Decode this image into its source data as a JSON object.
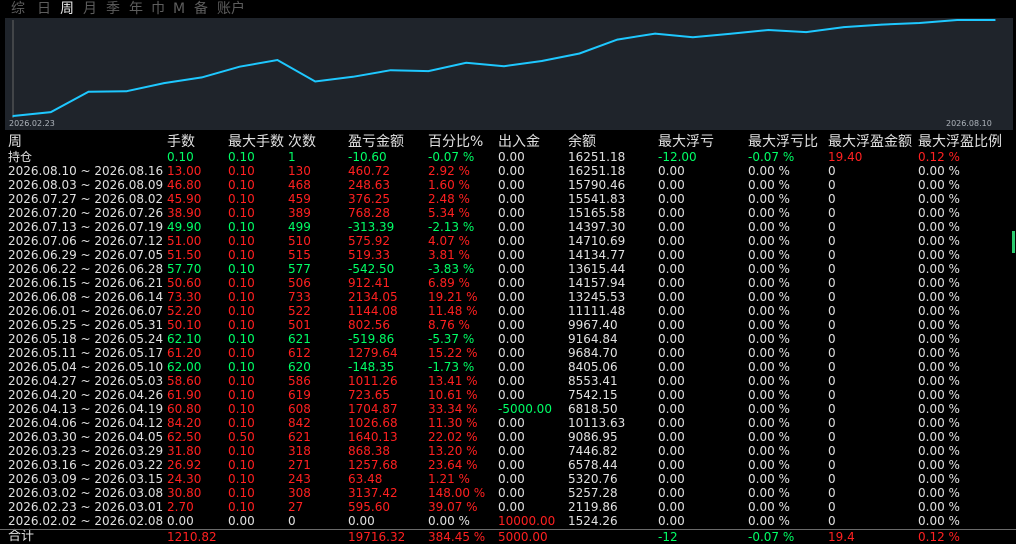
{
  "tabs": [
    "综",
    "日",
    "周",
    "月",
    "季",
    "年",
    "巾",
    "M",
    "备",
    "账户"
  ],
  "active_tab": "周",
  "chart_data": {
    "type": "line",
    "series_color": "#1ec8ff",
    "x_start_label": "2026.02.23",
    "x_end_label": "2026.08.10",
    "x": [
      "2026.02.02",
      "2026.02.23",
      "2026.03.02",
      "2026.03.09",
      "2026.03.16",
      "2026.03.23",
      "2026.03.30",
      "2026.04.06",
      "2026.04.13",
      "2026.04.20",
      "2026.04.27",
      "2026.05.04",
      "2026.05.11",
      "2026.05.18",
      "2026.05.25",
      "2026.06.01",
      "2026.06.08",
      "2026.06.15",
      "2026.06.22",
      "2026.06.29",
      "2026.07.06",
      "2026.07.13",
      "2026.07.20",
      "2026.07.27",
      "2026.08.03",
      "2026.08.10",
      "持仓"
    ],
    "values": [
      1524.26,
      2119.86,
      5257.28,
      5320.76,
      6578.44,
      7446.82,
      9086.95,
      10113.63,
      6818.5,
      7542.15,
      8553.41,
      8405.06,
      9684.7,
      9164.84,
      9967.4,
      11111.48,
      13245.53,
      14157.94,
      13615.44,
      14134.77,
      14710.69,
      14397.3,
      15165.58,
      15541.83,
      15790.46,
      16251.18,
      16251.18
    ]
  },
  "headers": [
    "周",
    "手数",
    "最大手数",
    "次数",
    "盈亏金额",
    "百分比%",
    "出入金",
    "余额",
    "最大浮亏",
    "最大浮亏比",
    "最大浮盈金额",
    "最大浮盈比例"
  ],
  "rows": [
    {
      "c": [
        "持仓",
        "0.10",
        "0.10",
        "1",
        "-10.60",
        "-0.07 %",
        "0.00",
        "16251.18",
        "-12.00",
        "-0.07 %",
        "19.40",
        "0.12 %"
      ],
      "col": [
        "w",
        "g",
        "g",
        "g",
        "g",
        "g",
        "w",
        "w",
        "g",
        "g",
        "r",
        "r"
      ]
    },
    {
      "c": [
        "2026.08.10 ~ 2026.08.16",
        "13.00",
        "0.10",
        "130",
        "460.72",
        "2.92 %",
        "0.00",
        "16251.18",
        "0.00",
        "0.00 %",
        "0",
        "0.00 %"
      ],
      "col": [
        "w",
        "r",
        "r",
        "r",
        "r",
        "r",
        "w",
        "w",
        "w",
        "w",
        "w",
        "w"
      ]
    },
    {
      "c": [
        "2026.08.03 ~ 2026.08.09",
        "46.80",
        "0.10",
        "468",
        "248.63",
        "1.60 %",
        "0.00",
        "15790.46",
        "0.00",
        "0.00 %",
        "0",
        "0.00 %"
      ],
      "col": [
        "w",
        "r",
        "r",
        "r",
        "r",
        "r",
        "w",
        "w",
        "w",
        "w",
        "w",
        "w"
      ]
    },
    {
      "c": [
        "2026.07.27 ~ 2026.08.02",
        "45.90",
        "0.10",
        "459",
        "376.25",
        "2.48 %",
        "0.00",
        "15541.83",
        "0.00",
        "0.00 %",
        "0",
        "0.00 %"
      ],
      "col": [
        "w",
        "r",
        "r",
        "r",
        "r",
        "r",
        "w",
        "w",
        "w",
        "w",
        "w",
        "w"
      ]
    },
    {
      "c": [
        "2026.07.20 ~ 2026.07.26",
        "38.90",
        "0.10",
        "389",
        "768.28",
        "5.34 %",
        "0.00",
        "15165.58",
        "0.00",
        "0.00 %",
        "0",
        "0.00 %"
      ],
      "col": [
        "w",
        "r",
        "r",
        "r",
        "r",
        "r",
        "w",
        "w",
        "w",
        "w",
        "w",
        "w"
      ]
    },
    {
      "c": [
        "2026.07.13 ~ 2026.07.19",
        "49.90",
        "0.10",
        "499",
        "-313.39",
        "-2.13 %",
        "0.00",
        "14397.30",
        "0.00",
        "0.00 %",
        "0",
        "0.00 %"
      ],
      "col": [
        "w",
        "g",
        "g",
        "g",
        "g",
        "g",
        "w",
        "w",
        "w",
        "w",
        "w",
        "w"
      ]
    },
    {
      "c": [
        "2026.07.06 ~ 2026.07.12",
        "51.00",
        "0.10",
        "510",
        "575.92",
        "4.07 %",
        "0.00",
        "14710.69",
        "0.00",
        "0.00 %",
        "0",
        "0.00 %"
      ],
      "col": [
        "w",
        "r",
        "r",
        "r",
        "r",
        "r",
        "w",
        "w",
        "w",
        "w",
        "w",
        "w"
      ]
    },
    {
      "c": [
        "2026.06.29 ~ 2026.07.05",
        "51.50",
        "0.10",
        "515",
        "519.33",
        "3.81 %",
        "0.00",
        "14134.77",
        "0.00",
        "0.00 %",
        "0",
        "0.00 %"
      ],
      "col": [
        "w",
        "r",
        "r",
        "r",
        "r",
        "r",
        "w",
        "w",
        "w",
        "w",
        "w",
        "w"
      ]
    },
    {
      "c": [
        "2026.06.22 ~ 2026.06.28",
        "57.70",
        "0.10",
        "577",
        "-542.50",
        "-3.83 %",
        "0.00",
        "13615.44",
        "0.00",
        "0.00 %",
        "0",
        "0.00 %"
      ],
      "col": [
        "w",
        "g",
        "g",
        "g",
        "g",
        "g",
        "w",
        "w",
        "w",
        "w",
        "w",
        "w"
      ]
    },
    {
      "c": [
        "2026.06.15 ~ 2026.06.21",
        "50.60",
        "0.10",
        "506",
        "912.41",
        "6.89 %",
        "0.00",
        "14157.94",
        "0.00",
        "0.00 %",
        "0",
        "0.00 %"
      ],
      "col": [
        "w",
        "r",
        "r",
        "r",
        "r",
        "r",
        "w",
        "w",
        "w",
        "w",
        "w",
        "w"
      ]
    },
    {
      "c": [
        "2026.06.08 ~ 2026.06.14",
        "73.30",
        "0.10",
        "733",
        "2134.05",
        "19.21 %",
        "0.00",
        "13245.53",
        "0.00",
        "0.00 %",
        "0",
        "0.00 %"
      ],
      "col": [
        "w",
        "r",
        "r",
        "r",
        "r",
        "r",
        "w",
        "w",
        "w",
        "w",
        "w",
        "w"
      ]
    },
    {
      "c": [
        "2026.06.01 ~ 2026.06.07",
        "52.20",
        "0.10",
        "522",
        "1144.08",
        "11.48 %",
        "0.00",
        "11111.48",
        "0.00",
        "0.00 %",
        "0",
        "0.00 %"
      ],
      "col": [
        "w",
        "r",
        "r",
        "r",
        "r",
        "r",
        "w",
        "w",
        "w",
        "w",
        "w",
        "w"
      ]
    },
    {
      "c": [
        "2026.05.25 ~ 2026.05.31",
        "50.10",
        "0.10",
        "501",
        "802.56",
        "8.76 %",
        "0.00",
        "9967.40",
        "0.00",
        "0.00 %",
        "0",
        "0.00 %"
      ],
      "col": [
        "w",
        "r",
        "r",
        "r",
        "r",
        "r",
        "w",
        "w",
        "w",
        "w",
        "w",
        "w"
      ]
    },
    {
      "c": [
        "2026.05.18 ~ 2026.05.24",
        "62.10",
        "0.10",
        "621",
        "-519.86",
        "-5.37 %",
        "0.00",
        "9164.84",
        "0.00",
        "0.00 %",
        "0",
        "0.00 %"
      ],
      "col": [
        "w",
        "g",
        "g",
        "g",
        "g",
        "g",
        "w",
        "w",
        "w",
        "w",
        "w",
        "w"
      ]
    },
    {
      "c": [
        "2026.05.11 ~ 2026.05.17",
        "61.20",
        "0.10",
        "612",
        "1279.64",
        "15.22 %",
        "0.00",
        "9684.70",
        "0.00",
        "0.00 %",
        "0",
        "0.00 %"
      ],
      "col": [
        "w",
        "r",
        "r",
        "r",
        "r",
        "r",
        "w",
        "w",
        "w",
        "w",
        "w",
        "w"
      ]
    },
    {
      "c": [
        "2026.05.04 ~ 2026.05.10",
        "62.00",
        "0.10",
        "620",
        "-148.35",
        "-1.73 %",
        "0.00",
        "8405.06",
        "0.00",
        "0.00 %",
        "0",
        "0.00 %"
      ],
      "col": [
        "w",
        "g",
        "g",
        "g",
        "g",
        "g",
        "w",
        "w",
        "w",
        "w",
        "w",
        "w"
      ]
    },
    {
      "c": [
        "2026.04.27 ~ 2026.05.03",
        "58.60",
        "0.10",
        "586",
        "1011.26",
        "13.41 %",
        "0.00",
        "8553.41",
        "0.00",
        "0.00 %",
        "0",
        "0.00 %"
      ],
      "col": [
        "w",
        "r",
        "r",
        "r",
        "r",
        "r",
        "w",
        "w",
        "w",
        "w",
        "w",
        "w"
      ]
    },
    {
      "c": [
        "2026.04.20 ~ 2026.04.26",
        "61.90",
        "0.10",
        "619",
        "723.65",
        "10.61 %",
        "0.00",
        "7542.15",
        "0.00",
        "0.00 %",
        "0",
        "0.00 %"
      ],
      "col": [
        "w",
        "r",
        "r",
        "r",
        "r",
        "r",
        "w",
        "w",
        "w",
        "w",
        "w",
        "w"
      ]
    },
    {
      "c": [
        "2026.04.13 ~ 2026.04.19",
        "60.80",
        "0.10",
        "608",
        "1704.87",
        "33.34 %",
        "-5000.00",
        "6818.50",
        "0.00",
        "0.00 %",
        "0",
        "0.00 %"
      ],
      "col": [
        "w",
        "r",
        "r",
        "r",
        "r",
        "r",
        "g",
        "w",
        "w",
        "w",
        "w",
        "w"
      ]
    },
    {
      "c": [
        "2026.04.06 ~ 2026.04.12",
        "84.20",
        "0.10",
        "842",
        "1026.68",
        "11.30 %",
        "0.00",
        "10113.63",
        "0.00",
        "0.00 %",
        "0",
        "0.00 %"
      ],
      "col": [
        "w",
        "r",
        "r",
        "r",
        "r",
        "r",
        "w",
        "w",
        "w",
        "w",
        "w",
        "w"
      ]
    },
    {
      "c": [
        "2026.03.30 ~ 2026.04.05",
        "62.50",
        "0.50",
        "621",
        "1640.13",
        "22.02 %",
        "0.00",
        "9086.95",
        "0.00",
        "0.00 %",
        "0",
        "0.00 %"
      ],
      "col": [
        "w",
        "r",
        "r",
        "r",
        "r",
        "r",
        "w",
        "w",
        "w",
        "w",
        "w",
        "w"
      ]
    },
    {
      "c": [
        "2026.03.23 ~ 2026.03.29",
        "31.80",
        "0.10",
        "318",
        "868.38",
        "13.20 %",
        "0.00",
        "7446.82",
        "0.00",
        "0.00 %",
        "0",
        "0.00 %"
      ],
      "col": [
        "w",
        "r",
        "r",
        "r",
        "r",
        "r",
        "w",
        "w",
        "w",
        "w",
        "w",
        "w"
      ]
    },
    {
      "c": [
        "2026.03.16 ~ 2026.03.22",
        "26.92",
        "0.10",
        "271",
        "1257.68",
        "23.64 %",
        "0.00",
        "6578.44",
        "0.00",
        "0.00 %",
        "0",
        "0.00 %"
      ],
      "col": [
        "w",
        "r",
        "r",
        "r",
        "r",
        "r",
        "w",
        "w",
        "w",
        "w",
        "w",
        "w"
      ]
    },
    {
      "c": [
        "2026.03.09 ~ 2026.03.15",
        "24.30",
        "0.10",
        "243",
        "63.48",
        "1.21 %",
        "0.00",
        "5320.76",
        "0.00",
        "0.00 %",
        "0",
        "0.00 %"
      ],
      "col": [
        "w",
        "r",
        "r",
        "r",
        "r",
        "r",
        "w",
        "w",
        "w",
        "w",
        "w",
        "w"
      ]
    },
    {
      "c": [
        "2026.03.02 ~ 2026.03.08",
        "30.80",
        "0.10",
        "308",
        "3137.42",
        "148.00 %",
        "0.00",
        "5257.28",
        "0.00",
        "0.00 %",
        "0",
        "0.00 %"
      ],
      "col": [
        "w",
        "r",
        "r",
        "r",
        "r",
        "r",
        "w",
        "w",
        "w",
        "w",
        "w",
        "w"
      ]
    },
    {
      "c": [
        "2026.02.23 ~ 2026.03.01",
        "2.70",
        "0.10",
        "27",
        "595.60",
        "39.07 %",
        "0.00",
        "2119.86",
        "0.00",
        "0.00 %",
        "0",
        "0.00 %"
      ],
      "col": [
        "w",
        "r",
        "r",
        "r",
        "r",
        "r",
        "w",
        "w",
        "w",
        "w",
        "w",
        "w"
      ]
    },
    {
      "c": [
        "2026.02.02 ~ 2026.02.08",
        "0.00",
        "0.00",
        "0",
        "0.00",
        "0.00 %",
        "10000.00",
        "1524.26",
        "0.00",
        "0.00 %",
        "0",
        "0.00 %"
      ],
      "col": [
        "w",
        "w",
        "w",
        "w",
        "w",
        "w",
        "r",
        "w",
        "w",
        "w",
        "w",
        "w"
      ]
    }
  ],
  "total": {
    "c": [
      "合计",
      "1210.82",
      "",
      "",
      "19716.32",
      "384.45 %",
      "5000.00",
      "",
      "-12",
      "-0.07 %",
      "19.4",
      "0.12 %"
    ],
    "col": [
      "w",
      "r",
      "w",
      "w",
      "r",
      "r",
      "r",
      "w",
      "g",
      "g",
      "r",
      "r"
    ]
  },
  "colors": {
    "red": "#ff2020",
    "green": "#00ff66",
    "line": "#1ec8ff",
    "chart_bg": "#1f242b"
  }
}
